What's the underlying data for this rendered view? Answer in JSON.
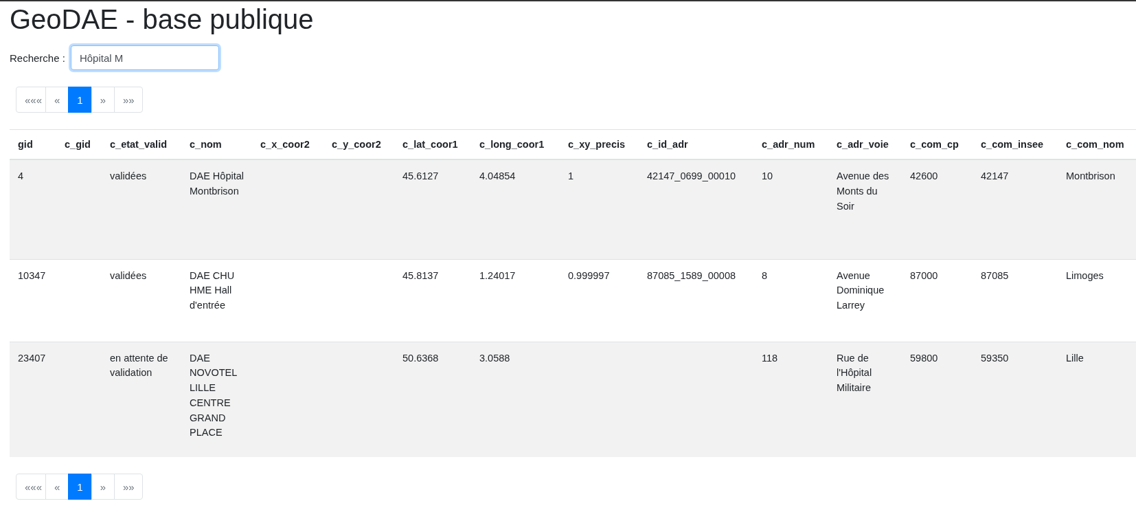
{
  "title": "GeoDAE - base publique",
  "search": {
    "label": "Recherche :",
    "value": "Hôpital M"
  },
  "pagination_top": [
    {
      "label": "«««",
      "selected": false
    },
    {
      "label": "«",
      "selected": false
    },
    {
      "label": "1",
      "selected": true
    },
    {
      "label": "»",
      "selected": false
    },
    {
      "label": "»»",
      "selected": false
    }
  ],
  "table": {
    "columns": [
      "gid",
      "c_gid",
      "c_etat_valid",
      "c_nom",
      "c_x_coor2",
      "c_y_coor2",
      "c_lat_coor1",
      "c_long_coor1",
      "c_xy_precis",
      "c_id_adr",
      "c_adr_num",
      "c_adr_voie",
      "c_com_cp",
      "c_com_insee",
      "c_com_nom"
    ],
    "rows": [
      [
        "4",
        "",
        "validées",
        "DAE Hôpital Montbrison",
        "",
        "",
        "45.6127",
        "4.04854",
        "1",
        "42147_0699_00010",
        "10",
        "Avenue des Monts du Soir",
        "42600",
        "42147",
        "Montbrison"
      ],
      [
        "10347",
        "",
        "validées",
        "DAE CHU HME Hall d'entrée",
        "",
        "",
        "45.8137",
        "1.24017",
        "0.999997",
        "87085_1589_00008",
        "8",
        "Avenue Dominique Larrey",
        "87000",
        "87085",
        "Limoges"
      ],
      [
        "23407",
        "",
        "en attente de validation",
        "DAE NOVOTEL LILLE CENTRE GRAND PLACE",
        "",
        "",
        "50.6368",
        "3.0588",
        "",
        "",
        "118",
        "Rue de l'Hôpital Militaire",
        "59800",
        "59350",
        "Lille"
      ]
    ]
  },
  "pagination_bottom": [
    {
      "label": "«««",
      "selected": false
    },
    {
      "label": "«",
      "selected": false
    },
    {
      "label": "1",
      "selected": true
    },
    {
      "label": "»",
      "selected": false
    },
    {
      "label": "»»",
      "selected": false
    }
  ]
}
